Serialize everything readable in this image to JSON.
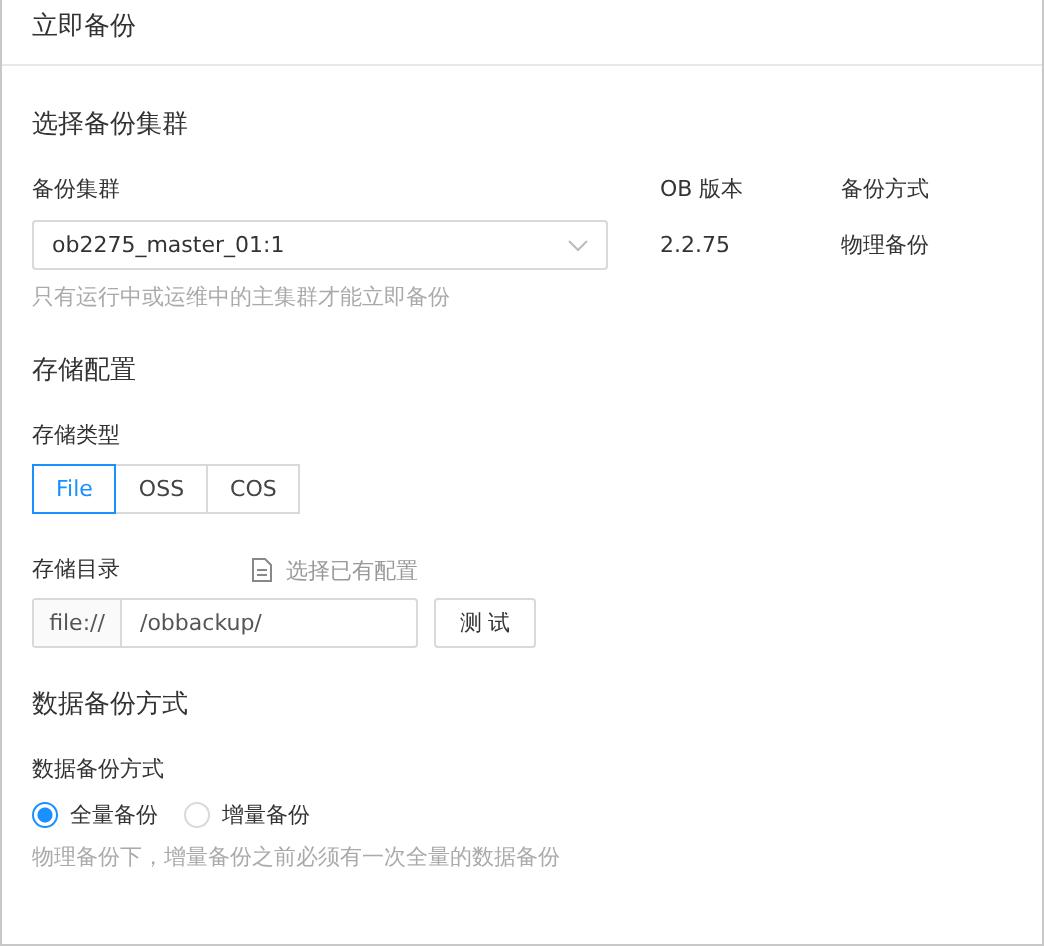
{
  "panel": {
    "title": "立即备份"
  },
  "cluster_section": {
    "title": "选择备份集群",
    "cluster_label": "备份集群",
    "cluster_value": "ob2275_master_01:1",
    "version_label": "OB 版本",
    "version_value": "2.2.75",
    "mode_label": "备份方式",
    "mode_value": "物理备份",
    "hint": "只有运行中或运维中的主集群才能立即备份"
  },
  "storage_section": {
    "title": "存储配置",
    "type_label": "存储类型",
    "types": [
      {
        "label": "File",
        "selected": true
      },
      {
        "label": "OSS",
        "selected": false
      },
      {
        "label": "COS",
        "selected": false
      }
    ],
    "dir_label": "存储目录",
    "existing_link": "选择已有配置",
    "dir_prefix": "file://",
    "dir_value": "/obbackup/",
    "test_button": "测 试"
  },
  "data_section": {
    "title": "数据备份方式",
    "label": "数据备份方式",
    "options": [
      {
        "label": "全量备份",
        "selected": true
      },
      {
        "label": "增量备份",
        "selected": false
      }
    ],
    "hint": "物理备份下，增量备份之前必须有一次全量的数据备份"
  }
}
